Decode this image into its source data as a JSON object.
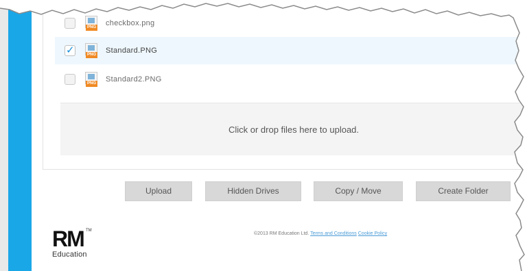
{
  "files": [
    {
      "name": "checkbox.png",
      "checked": false,
      "type": "PNG"
    },
    {
      "name": "Standard.PNG",
      "checked": true,
      "type": "PNG"
    },
    {
      "name": "Standard2.PNG",
      "checked": false,
      "type": "PNG"
    }
  ],
  "dropzone": {
    "text": "Click or drop files here to upload."
  },
  "actions": {
    "upload": "Upload",
    "hidden_drives": "Hidden Drives",
    "copy_move": "Copy / Move",
    "create_folder": "Create Folder"
  },
  "footer": {
    "copyright": "©2013 RM Education Ltd.",
    "terms": "Terms and Conditions",
    "cookie": "Cookie Policy"
  },
  "logo": {
    "mark": "RM",
    "tm": "TM",
    "sub": "Education"
  },
  "colors": {
    "accent_blue": "#1aa7e8",
    "selected_row": "#eef7fd",
    "png_tag": "#f08a24"
  }
}
